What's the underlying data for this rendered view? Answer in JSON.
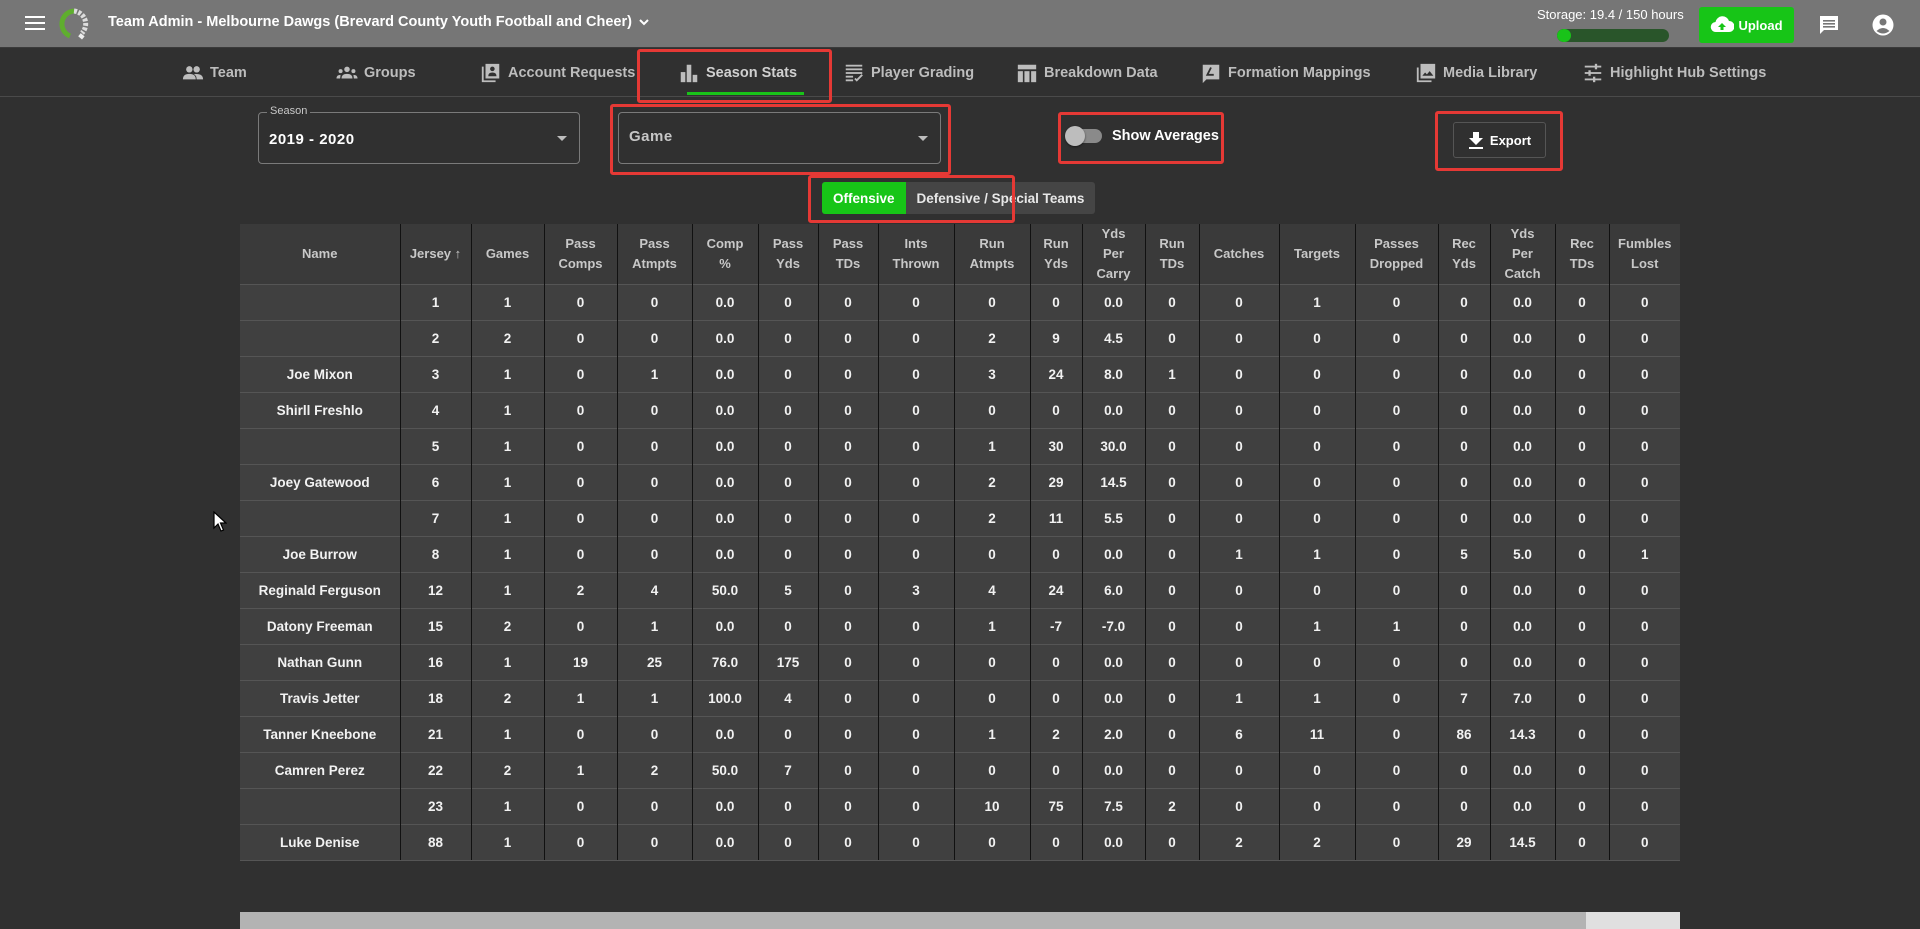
{
  "header": {
    "title": "Team Admin - Melbourne Dawgs (Brevard County Youth Football and Cheer)",
    "storage_label": "Storage: 19.4 / 150 hours",
    "storage_used": 19.4,
    "storage_total": 150,
    "upload_label": "Upload",
    "icons": [
      "menu-icon",
      "app-logo",
      "chevron-down-icon",
      "cloud-upload-icon",
      "chat-icon",
      "account-circle-icon"
    ]
  },
  "nav": {
    "tabs": [
      {
        "label": "Team",
        "icon": "people-icon"
      },
      {
        "label": "Groups",
        "icon": "groups-icon"
      },
      {
        "label": "Account Requests",
        "icon": "contact-page-icon"
      },
      {
        "label": "Season Stats",
        "icon": "bar-chart-icon",
        "active": true
      },
      {
        "label": "Player Grading",
        "icon": "grading-icon"
      },
      {
        "label": "Breakdown Data",
        "icon": "table-chart-icon"
      },
      {
        "label": "Formation Mappings",
        "icon": "draw-icon"
      },
      {
        "label": "Media Library",
        "icon": "photo-library-icon"
      },
      {
        "label": "Highlight Hub Settings",
        "icon": "tune-icon"
      }
    ]
  },
  "filters": {
    "season_label": "Season",
    "season_value": "2019 - 2020",
    "game_placeholder": "Game",
    "show_averages_label": "Show Averages",
    "show_averages_on": false,
    "export_label": "Export",
    "segments": [
      "Offensive",
      "Defensive / Special Teams"
    ],
    "active_segment": "Offensive"
  },
  "colors": {
    "accent_green": "#17c517",
    "highlight_red": "#e53935"
  },
  "table": {
    "sorted_by": "Jersey",
    "sort_direction": "ascending",
    "columns": [
      [
        "Name"
      ],
      [
        "Jersey ↑"
      ],
      [
        "Games"
      ],
      [
        "Pass",
        "Comps"
      ],
      [
        "Pass",
        "Atmpts"
      ],
      [
        "Comp",
        "%"
      ],
      [
        "Pass",
        "Yds"
      ],
      [
        "Pass",
        "TDs"
      ],
      [
        "Ints",
        "Thrown"
      ],
      [
        "Run",
        "Atmpts"
      ],
      [
        "Run",
        "Yds"
      ],
      [
        "Yds",
        "Per",
        "Carry"
      ],
      [
        "Run",
        "TDs"
      ],
      [
        "Catches"
      ],
      [
        "Targets"
      ],
      [
        "Passes",
        "Dropped"
      ],
      [
        "Rec",
        "Yds"
      ],
      [
        "Yds",
        "Per",
        "Catch"
      ],
      [
        "Rec",
        "TDs"
      ],
      [
        "Fumbles",
        "Lost"
      ]
    ],
    "rows": [
      [
        "",
        "1",
        "1",
        "0",
        "0",
        "0.0",
        "0",
        "0",
        "0",
        "0",
        "0",
        "0.0",
        "0",
        "0",
        "1",
        "0",
        "0",
        "0.0",
        "0",
        "0"
      ],
      [
        "",
        "2",
        "2",
        "0",
        "0",
        "0.0",
        "0",
        "0",
        "0",
        "2",
        "9",
        "4.5",
        "0",
        "0",
        "0",
        "0",
        "0",
        "0.0",
        "0",
        "0"
      ],
      [
        "Joe Mixon",
        "3",
        "1",
        "0",
        "1",
        "0.0",
        "0",
        "0",
        "0",
        "3",
        "24",
        "8.0",
        "1",
        "0",
        "0",
        "0",
        "0",
        "0.0",
        "0",
        "0"
      ],
      [
        "Shirll Freshlo",
        "4",
        "1",
        "0",
        "0",
        "0.0",
        "0",
        "0",
        "0",
        "0",
        "0",
        "0.0",
        "0",
        "0",
        "0",
        "0",
        "0",
        "0.0",
        "0",
        "0"
      ],
      [
        "",
        "5",
        "1",
        "0",
        "0",
        "0.0",
        "0",
        "0",
        "0",
        "1",
        "30",
        "30.0",
        "0",
        "0",
        "0",
        "0",
        "0",
        "0.0",
        "0",
        "0"
      ],
      [
        "Joey Gatewood",
        "6",
        "1",
        "0",
        "0",
        "0.0",
        "0",
        "0",
        "0",
        "2",
        "29",
        "14.5",
        "0",
        "0",
        "0",
        "0",
        "0",
        "0.0",
        "0",
        "0"
      ],
      [
        "",
        "7",
        "1",
        "0",
        "0",
        "0.0",
        "0",
        "0",
        "0",
        "2",
        "11",
        "5.5",
        "0",
        "0",
        "0",
        "0",
        "0",
        "0.0",
        "0",
        "0"
      ],
      [
        "Joe Burrow",
        "8",
        "1",
        "0",
        "0",
        "0.0",
        "0",
        "0",
        "0",
        "0",
        "0",
        "0.0",
        "0",
        "1",
        "1",
        "0",
        "5",
        "5.0",
        "0",
        "1"
      ],
      [
        "Reginald Ferguson",
        "12",
        "1",
        "2",
        "4",
        "50.0",
        "5",
        "0",
        "3",
        "4",
        "24",
        "6.0",
        "0",
        "0",
        "0",
        "0",
        "0",
        "0.0",
        "0",
        "0"
      ],
      [
        "Datony Freeman",
        "15",
        "2",
        "0",
        "1",
        "0.0",
        "0",
        "0",
        "0",
        "1",
        "-7",
        "-7.0",
        "0",
        "0",
        "1",
        "1",
        "0",
        "0.0",
        "0",
        "0"
      ],
      [
        "Nathan Gunn",
        "16",
        "1",
        "19",
        "25",
        "76.0",
        "175",
        "0",
        "0",
        "0",
        "0",
        "0.0",
        "0",
        "0",
        "0",
        "0",
        "0",
        "0.0",
        "0",
        "0"
      ],
      [
        "Travis Jetter",
        "18",
        "2",
        "1",
        "1",
        "100.0",
        "4",
        "0",
        "0",
        "0",
        "0",
        "0.0",
        "0",
        "1",
        "1",
        "0",
        "7",
        "7.0",
        "0",
        "0"
      ],
      [
        "Tanner Kneebone",
        "21",
        "1",
        "0",
        "0",
        "0.0",
        "0",
        "0",
        "0",
        "1",
        "2",
        "2.0",
        "0",
        "6",
        "11",
        "0",
        "86",
        "14.3",
        "0",
        "0"
      ],
      [
        "Camren Perez",
        "22",
        "2",
        "1",
        "2",
        "50.0",
        "7",
        "0",
        "0",
        "0",
        "0",
        "0.0",
        "0",
        "0",
        "0",
        "0",
        "0",
        "0.0",
        "0",
        "0"
      ],
      [
        "",
        "23",
        "1",
        "0",
        "0",
        "0.0",
        "0",
        "0",
        "0",
        "10",
        "75",
        "7.5",
        "2",
        "0",
        "0",
        "0",
        "0",
        "0.0",
        "0",
        "0"
      ],
      [
        "Luke Denise",
        "88",
        "1",
        "0",
        "0",
        "0.0",
        "0",
        "0",
        "0",
        "0",
        "0",
        "0.0",
        "0",
        "2",
        "2",
        "0",
        "29",
        "14.5",
        "0",
        "0"
      ]
    ]
  },
  "scrollbar": {
    "horizontal_visible_fraction": 0.935
  }
}
